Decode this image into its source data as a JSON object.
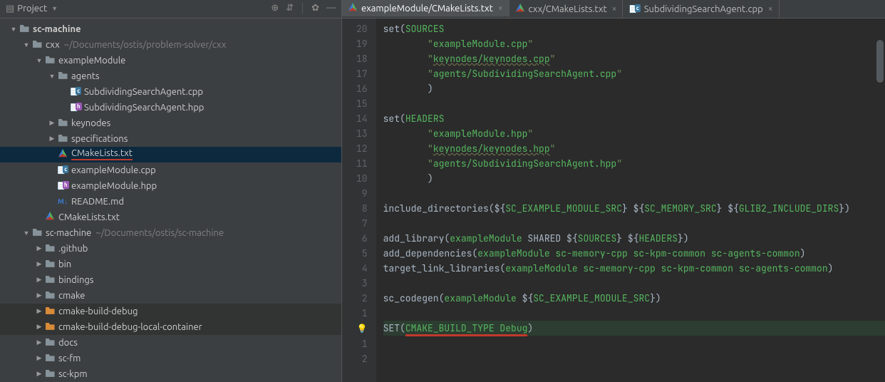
{
  "sidebar": {
    "title": "Project",
    "tree": [
      {
        "indent": 0,
        "chev": "▼",
        "icon": "folder",
        "label": "sc-machine",
        "bold": true
      },
      {
        "indent": 1,
        "chev": "▼",
        "icon": "folder",
        "label": "cxx",
        "hint": "~/Documents/ostis/problem-solver/cxx"
      },
      {
        "indent": 2,
        "chev": "▼",
        "icon": "folder",
        "label": "exampleModule"
      },
      {
        "indent": 3,
        "chev": "▼",
        "icon": "folder",
        "label": "agents"
      },
      {
        "indent": 4,
        "chev": "",
        "icon": "cpp",
        "label": "SubdividingSearchAgent.cpp"
      },
      {
        "indent": 4,
        "chev": "",
        "icon": "hpp",
        "label": "SubdividingSearchAgent.hpp"
      },
      {
        "indent": 3,
        "chev": "▶",
        "icon": "folder",
        "label": "keynodes"
      },
      {
        "indent": 3,
        "chev": "▶",
        "icon": "folder",
        "label": "specifications"
      },
      {
        "indent": 3,
        "chev": "",
        "icon": "cmake",
        "label": "CMakeLists.txt",
        "selected": true,
        "underlineRed": true
      },
      {
        "indent": 3,
        "chev": "",
        "icon": "cpp",
        "label": "exampleModule.cpp"
      },
      {
        "indent": 3,
        "chev": "",
        "icon": "hpp",
        "label": "exampleModule.hpp"
      },
      {
        "indent": 3,
        "chev": "",
        "icon": "md",
        "label": "README.md"
      },
      {
        "indent": 2,
        "chev": "",
        "icon": "cmake",
        "label": "CMakeLists.txt"
      },
      {
        "indent": 1,
        "chev": "▼",
        "icon": "folder",
        "label": "sc-machine",
        "hint": "~/Documents/ostis/sc-machine"
      },
      {
        "indent": 2,
        "chev": "▶",
        "icon": "folder",
        "label": ".github"
      },
      {
        "indent": 2,
        "chev": "▶",
        "icon": "folder",
        "label": "bin"
      },
      {
        "indent": 2,
        "chev": "▶",
        "icon": "folder",
        "label": "bindings"
      },
      {
        "indent": 2,
        "chev": "▶",
        "icon": "folder",
        "label": "cmake"
      },
      {
        "indent": 2,
        "chev": "▶",
        "icon": "folder-orange",
        "label": "cmake-build-debug",
        "dim": true
      },
      {
        "indent": 2,
        "chev": "▶",
        "icon": "folder-orange",
        "label": "cmake-build-debug-local-container",
        "dim": true
      },
      {
        "indent": 2,
        "chev": "▶",
        "icon": "folder",
        "label": "docs"
      },
      {
        "indent": 2,
        "chev": "▶",
        "icon": "folder",
        "label": "sc-fm"
      },
      {
        "indent": 2,
        "chev": "▶",
        "icon": "folder",
        "label": "sc-kpm"
      }
    ]
  },
  "tabs": [
    {
      "icon": "cmake",
      "label": "exampleModule/CMakeLists.txt",
      "active": true
    },
    {
      "icon": "cmake",
      "label": "cxx/CMakeLists.txt"
    },
    {
      "icon": "cpp",
      "label": "SubdividingSearchAgent.cpp"
    }
  ],
  "gutter": [
    "20",
    "19",
    "18",
    "17",
    "16",
    "15",
    "14",
    "13",
    "12",
    "11",
    "10",
    "9",
    "8",
    "7",
    "6",
    "5",
    "4",
    "3",
    "2",
    "1",
    "",
    "1",
    "2"
  ],
  "code_lines": [
    {
      "seg": [
        {
          "c": "k-cmd",
          "t": "set("
        },
        {
          "c": "k-kw",
          "t": "SOURCES"
        }
      ]
    },
    {
      "seg": [
        {
          "c": "k-str",
          "t": "        \""
        },
        {
          "c": "k-str-bright",
          "t": "exampleModule.cpp"
        },
        {
          "c": "k-str",
          "t": "\""
        }
      ]
    },
    {
      "seg": [
        {
          "c": "k-str",
          "t": "        \""
        },
        {
          "c": "k-str-bright wavy",
          "t": "keynodes/keynodes.cpp"
        },
        {
          "c": "k-str",
          "t": "\""
        }
      ]
    },
    {
      "seg": [
        {
          "c": "k-str",
          "t": "        \""
        },
        {
          "c": "k-str-bright",
          "t": "agents/SubdividingSearchAgent.cpp"
        },
        {
          "c": "k-str",
          "t": "\""
        }
      ]
    },
    {
      "seg": [
        {
          "c": "k-cmd",
          "t": "        )"
        }
      ]
    },
    {
      "seg": []
    },
    {
      "seg": [
        {
          "c": "k-cmd",
          "t": "set("
        },
        {
          "c": "k-kw",
          "t": "HEADERS"
        }
      ]
    },
    {
      "seg": [
        {
          "c": "k-str",
          "t": "        \""
        },
        {
          "c": "k-str-bright",
          "t": "exampleModule.hpp"
        },
        {
          "c": "k-str",
          "t": "\""
        }
      ]
    },
    {
      "seg": [
        {
          "c": "k-str",
          "t": "        \""
        },
        {
          "c": "k-str-bright wavy",
          "t": "keynodes/keynodes.hpp"
        },
        {
          "c": "k-str",
          "t": "\""
        }
      ]
    },
    {
      "seg": [
        {
          "c": "k-str",
          "t": "        \""
        },
        {
          "c": "k-str-bright",
          "t": "agents/SubdividingSearchAgent.hpp"
        },
        {
          "c": "k-str",
          "t": "\""
        }
      ]
    },
    {
      "seg": [
        {
          "c": "k-cmd",
          "t": "        )"
        }
      ]
    },
    {
      "seg": []
    },
    {
      "seg": [
        {
          "c": "k-cmd",
          "t": "include_directories("
        },
        {
          "c": "k-punc",
          "t": "${"
        },
        {
          "c": "k-var",
          "t": "SC_EXAMPLE_MODULE_SRC"
        },
        {
          "c": "k-punc",
          "t": "} ${"
        },
        {
          "c": "k-var",
          "t": "SC_MEMORY_SRC"
        },
        {
          "c": "k-punc",
          "t": "} ${"
        },
        {
          "c": "k-var",
          "t": "GLIB2_INCLUDE_DIRS"
        },
        {
          "c": "k-punc",
          "t": "}"
        },
        {
          "c": "k-cmd",
          "t": ")"
        }
      ]
    },
    {
      "seg": []
    },
    {
      "seg": [
        {
          "c": "k-cmd",
          "t": "add_library("
        },
        {
          "c": "k-var",
          "t": "exampleModule"
        },
        {
          "c": "k-cmd",
          "t": " SHARED "
        },
        {
          "c": "k-punc",
          "t": "${"
        },
        {
          "c": "k-var",
          "t": "SOURCES"
        },
        {
          "c": "k-punc",
          "t": "} ${"
        },
        {
          "c": "k-var",
          "t": "HEADERS"
        },
        {
          "c": "k-punc",
          "t": "}"
        },
        {
          "c": "k-cmd",
          "t": ")"
        }
      ]
    },
    {
      "seg": [
        {
          "c": "k-cmd",
          "t": "add_dependencies("
        },
        {
          "c": "k-var",
          "t": "exampleModule sc-memory-cpp sc-kpm-common sc-agents-common"
        },
        {
          "c": "k-cmd",
          "t": ")"
        }
      ]
    },
    {
      "seg": [
        {
          "c": "k-cmd",
          "t": "target_link_libraries("
        },
        {
          "c": "k-var",
          "t": "exampleModule sc-memory-cpp sc-kpm-common sc-agents-common"
        },
        {
          "c": "k-cmd",
          "t": ")"
        }
      ]
    },
    {
      "seg": []
    },
    {
      "seg": [
        {
          "c": "k-cmd",
          "t": "sc_codegen("
        },
        {
          "c": "k-var",
          "t": "exampleModule"
        },
        {
          "c": "k-cmd",
          "t": " "
        },
        {
          "c": "k-punc",
          "t": "${"
        },
        {
          "c": "k-var",
          "t": "SC_EXAMPLE_MODULE_SRC"
        },
        {
          "c": "k-punc",
          "t": "}"
        },
        {
          "c": "k-cmd",
          "t": ")"
        }
      ]
    },
    {
      "seg": []
    },
    {
      "caret": true,
      "seg": [
        {
          "c": "k-cmd",
          "t": "SET("
        },
        {
          "c": "k-var red-underline",
          "t": "CMAKE_BUILD_TYPE Debug"
        },
        {
          "c": "k-cmd",
          "t": ")"
        }
      ]
    },
    {
      "seg": []
    },
    {
      "seg": []
    }
  ]
}
